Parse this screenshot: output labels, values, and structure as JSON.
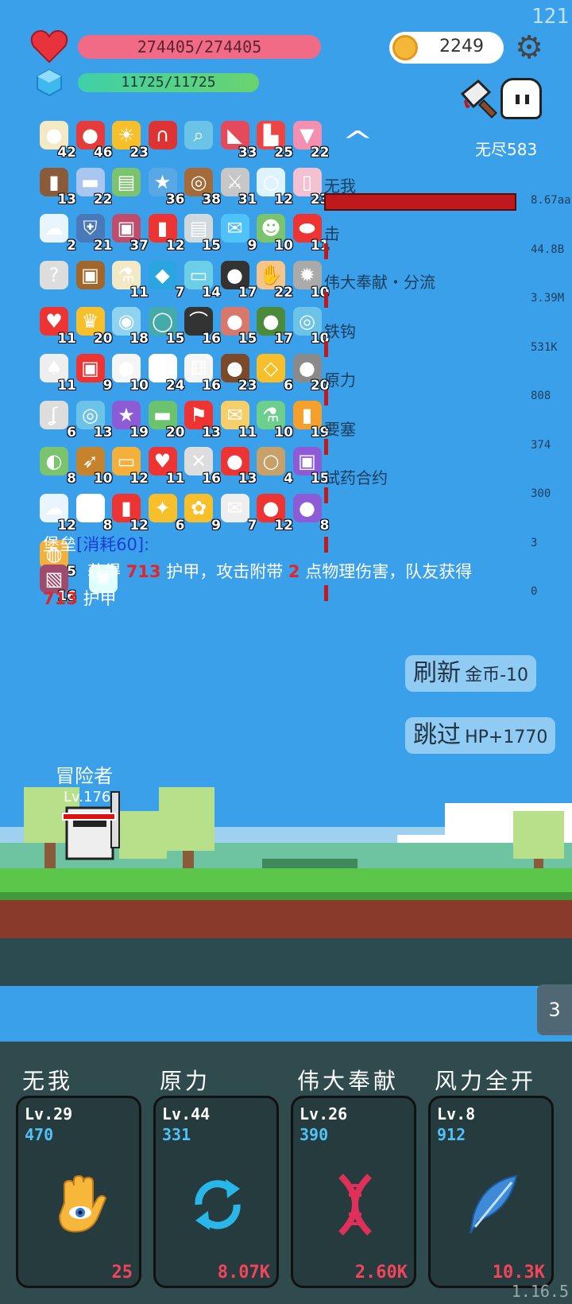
{
  "fps": "121",
  "player": {
    "hp": "274405/274405",
    "mp": "11725/11725",
    "gold": "2249",
    "endless": "无尽583"
  },
  "items": [
    {
      "n": "42",
      "icon": "egg-icon",
      "c": "#f3e9c4"
    },
    {
      "n": "46",
      "icon": "apple-icon",
      "c": "#e63b3b"
    },
    {
      "n": "23",
      "icon": "sun-icon",
      "c": "#f7c02b"
    },
    {
      "n": "",
      "icon": "magnet-icon",
      "c": "#d33"
    },
    {
      "n": "",
      "icon": "magnifier-icon",
      "c": "#6cc3e8"
    },
    {
      "n": "33",
      "icon": "watermelon-icon",
      "c": "#e44a5b"
    },
    {
      "n": "25",
      "icon": "sock-icon",
      "c": "#e44"
    },
    {
      "n": "22",
      "icon": "icecream-icon",
      "c": "#f48fb1"
    },
    {
      "n": "13",
      "icon": "door-icon",
      "c": "#8a5a3b"
    },
    {
      "n": "22",
      "icon": "eraser-icon",
      "c": "#a8c6f0"
    },
    {
      "n": "",
      "icon": "note-icon",
      "c": "#7cc36e"
    },
    {
      "n": "36",
      "icon": "star-card-icon",
      "c": "#58a8e6"
    },
    {
      "n": "38",
      "icon": "donut-icon",
      "c": "#a46a38"
    },
    {
      "n": "31",
      "icon": "sword-icon",
      "c": "#c7c7c7"
    },
    {
      "n": "12",
      "icon": "halo-icon",
      "c": "#dff3ff"
    },
    {
      "n": "23",
      "icon": "bottle-icon",
      "c": "#f3c1d1"
    },
    {
      "n": "2",
      "icon": "cloud-icon",
      "c": "#e8f4ff"
    },
    {
      "n": "21",
      "icon": "shield-icon",
      "c": "#4a79b9"
    },
    {
      "n": "37",
      "icon": "jar-icon",
      "c": "#c04b6b"
    },
    {
      "n": "12",
      "icon": "red-card-icon",
      "c": "#e33"
    },
    {
      "n": "15",
      "icon": "clipboard-icon",
      "c": "#cfd8dc"
    },
    {
      "n": "9",
      "icon": "chat-icon",
      "c": "#4fc3f7"
    },
    {
      "n": "10",
      "icon": "slime-icon",
      "c": "#7cc36e"
    },
    {
      "n": "11",
      "icon": "pill-icon",
      "c": "#e33"
    },
    {
      "n": "",
      "icon": "hook-icon",
      "c": "#ddd"
    },
    {
      "n": "",
      "icon": "chest-icon",
      "c": "#a0662a"
    },
    {
      "n": "11",
      "icon": "potion-icon",
      "c": "#f3e9c4"
    },
    {
      "n": "7",
      "icon": "gem-icon",
      "c": "#2aa5e0"
    },
    {
      "n": "14",
      "icon": "scroll-icon",
      "c": "#6ccfe8"
    },
    {
      "n": "17",
      "icon": "pig-icon",
      "c": "#333"
    },
    {
      "n": "22",
      "icon": "glove-icon",
      "c": "#f5c58a"
    },
    {
      "n": "10",
      "icon": "spike-icon",
      "c": "#aaa"
    },
    {
      "n": "11",
      "icon": "heart-icon",
      "c": "#e33"
    },
    {
      "n": "20",
      "icon": "crown-icon",
      "c": "#f7c02b"
    },
    {
      "n": "18",
      "icon": "orb-icon",
      "c": "#8fd3f0"
    },
    {
      "n": "15",
      "icon": "ring-icon",
      "c": "#4aa"
    },
    {
      "n": "16",
      "icon": "bat-icon",
      "c": "#333"
    },
    {
      "n": "15",
      "icon": "meat-icon",
      "c": "#d9776a"
    },
    {
      "n": "17",
      "icon": "grenade-icon",
      "c": "#4a8a3a"
    },
    {
      "n": "10",
      "icon": "target-icon",
      "c": "#6cc3e8"
    },
    {
      "n": "11",
      "icon": "card-icon",
      "c": "#eee"
    },
    {
      "n": "9",
      "icon": "gift-icon",
      "c": "#e33"
    },
    {
      "n": "10",
      "icon": "bulb-icon",
      "c": "#f5f5f5"
    },
    {
      "n": "24",
      "icon": "fried-egg-icon",
      "c": "#fff"
    },
    {
      "n": "16",
      "icon": "dice-icon",
      "c": "#f5f5f5"
    },
    {
      "n": "23",
      "icon": "coconut-icon",
      "c": "#7a4a2a"
    },
    {
      "n": "6",
      "icon": "diamond-ring-icon",
      "c": "#f7c02b"
    },
    {
      "n": "20",
      "icon": "boulder-icon",
      "c": "#8a8a8a"
    },
    {
      "n": "6",
      "icon": "fishhook-icon",
      "c": "#ddd"
    },
    {
      "n": "13",
      "icon": "compass-icon",
      "c": "#6cc3e8"
    },
    {
      "n": "19",
      "icon": "badge-icon",
      "c": "#8e5bd6"
    },
    {
      "n": "20",
      "icon": "cash-icon",
      "c": "#6cc36e"
    },
    {
      "n": "13",
      "icon": "banner-icon",
      "c": "#e33"
    },
    {
      "n": "11",
      "icon": "letter-icon",
      "c": "#f5d06a"
    },
    {
      "n": "10",
      "icon": "flask-icon",
      "c": "#6ccf8e"
    },
    {
      "n": "19",
      "icon": "book-icon",
      "c": "#f5a02b"
    },
    {
      "n": "8",
      "icon": "lime-icon",
      "c": "#7cc36e"
    },
    {
      "n": "10",
      "icon": "bow-icon",
      "c": "#c7832b"
    },
    {
      "n": "12",
      "icon": "scroll2-icon",
      "c": "#f5b03b"
    },
    {
      "n": "11",
      "icon": "heart-wing-icon",
      "c": "#e33"
    },
    {
      "n": "16",
      "icon": "bone-icon",
      "c": "#ddd"
    },
    {
      "n": "13",
      "icon": "strawberry-icon",
      "c": "#e33"
    },
    {
      "n": "4",
      "icon": "noose-icon",
      "c": "#c7a06a"
    },
    {
      "n": "15",
      "icon": "box-icon",
      "c": "#8e5bd6"
    },
    {
      "n": "12",
      "icon": "storm-icon",
      "c": "#e8f4ff"
    },
    {
      "n": "8",
      "icon": "ghost-icon",
      "c": "#fff"
    },
    {
      "n": "12",
      "icon": "thermometer-icon",
      "c": "#e33"
    },
    {
      "n": "6",
      "icon": "wand-icon",
      "c": "#f7c02b"
    },
    {
      "n": "9",
      "icon": "sunflower-icon",
      "c": "#f7c02b"
    },
    {
      "n": "7",
      "icon": "envelope-icon",
      "c": "#eee"
    },
    {
      "n": "12",
      "icon": "mushroom-icon",
      "c": "#e33"
    },
    {
      "n": "8",
      "icon": "crystal-ball-icon",
      "c": "#8e5bd6"
    },
    {
      "n": "5",
      "icon": "coins-icon",
      "c": "#f5b03b"
    }
  ],
  "extra_items": [
    {
      "n": "16",
      "icon": "striped-card-icon",
      "c": "#a04b6b"
    },
    {
      "n": "",
      "icon": "spark-icon",
      "c": "#dff"
    }
  ],
  "damage": [
    {
      "name": "无我",
      "value": "8.67aa"
    },
    {
      "name": "击",
      "value": "44.8B"
    },
    {
      "name": "伟大奉献・分流",
      "value": "3.39M"
    },
    {
      "name": "铁钩",
      "value": "531K"
    },
    {
      "name": "原力",
      "value": "808"
    },
    {
      "name": "要塞",
      "value": "374"
    },
    {
      "name": "试药合约",
      "value": "300"
    },
    {
      "name": "",
      "value": "3"
    },
    {
      "name": "",
      "value": "0"
    }
  ],
  "desc": {
    "name": "堡垒",
    "cost": "[消耗60]:",
    "colon": "",
    "line1a": "获得",
    "armor": "713",
    "line1b": "护甲，攻击附带",
    "dmg": "2",
    "line1c": "点物理伤害，队友获得",
    "armor2": "713",
    "line2": "护甲"
  },
  "buttons": {
    "refresh": "刷新",
    "refresh_cost": "金币-10",
    "skip": "跳过",
    "skip_gain": "HP+1770"
  },
  "hero": {
    "name": "冒险者",
    "level": "Lv.176"
  },
  "side_tab": "3",
  "skills": [
    {
      "title": "无我",
      "lv": "Lv.29",
      "cost": "470",
      "dmg": "25",
      "icon": "eye-hand-icon"
    },
    {
      "title": "原力",
      "lv": "Lv.44",
      "cost": "331",
      "dmg": "8.07K",
      "icon": "cycle-icon"
    },
    {
      "title": "伟大奉献",
      "lv": "Lv.26",
      "cost": "390",
      "dmg": "2.60K",
      "icon": "dna-icon"
    },
    {
      "title": "风力全开",
      "lv": "Lv.8",
      "cost": "912",
      "dmg": "10.3K",
      "icon": "feather-icon"
    }
  ],
  "version": "1.16.5"
}
